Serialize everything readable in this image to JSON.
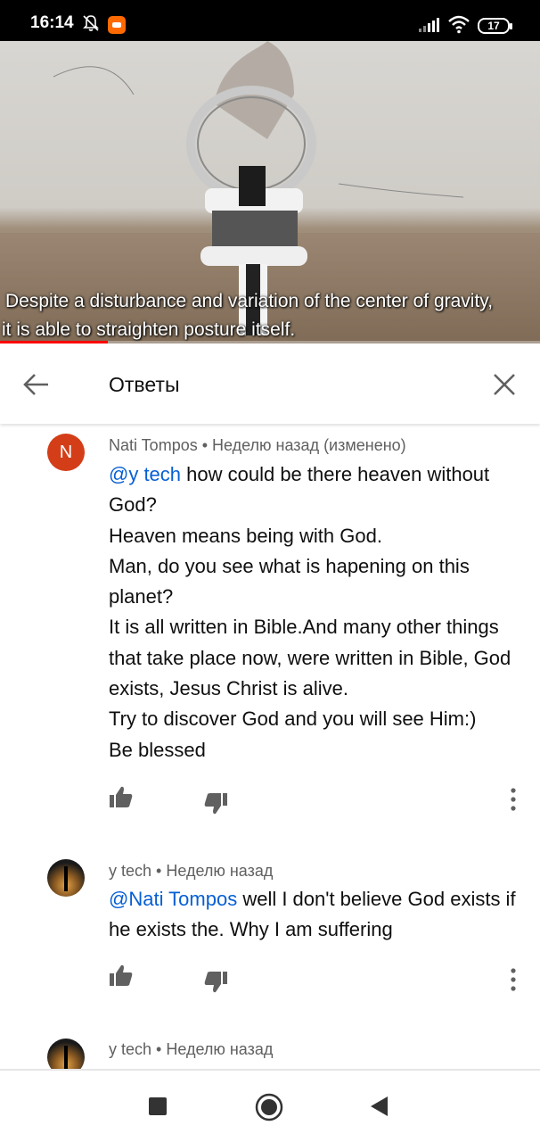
{
  "status_bar": {
    "time": "16:14",
    "battery": "17",
    "icons": [
      "bell-off-icon",
      "mi-app-icon",
      "signal-icon",
      "wifi-icon",
      "battery-icon"
    ]
  },
  "video": {
    "subtitle_line1": "Despite a disturbance and variation of the center of gravity,",
    "subtitle_line2": "it is able to straighten posture itself.",
    "progress": 0.2,
    "progress_color": "#ff0000"
  },
  "header": {
    "title": "Ответы",
    "back_icon": "arrow-left-icon",
    "close_icon": "close-icon"
  },
  "comments": [
    {
      "avatar_letter": "N",
      "avatar_color": "#d33e18",
      "meta": "Nati Tompos • Неделю назад (изменено)",
      "mention": "@y tech",
      "text_after_mention": " how could be there heaven without God?",
      "paragraphs": [
        "Heaven means being with God.",
        "Man, do you see what is hapening on this planet?",
        "It is all written in Bible.And many other things that take place now, were written in Bible, God exists, Jesus Christ is alive.",
        "Try to discover God and you will see Him:)",
        "Be blessed"
      ]
    },
    {
      "avatar": "photo",
      "meta": "y tech • Неделю назад",
      "mention": "@Nati Tompos",
      "text_after_mention": " well I don't believe God exists if he exists the. Why I am suffering"
    },
    {
      "avatar": "photo",
      "meta": "y tech • Неделю назад"
    }
  ],
  "colors": {
    "mention": "#065fd4",
    "meta_text": "#606060",
    "body_text": "#0f0f0f"
  }
}
